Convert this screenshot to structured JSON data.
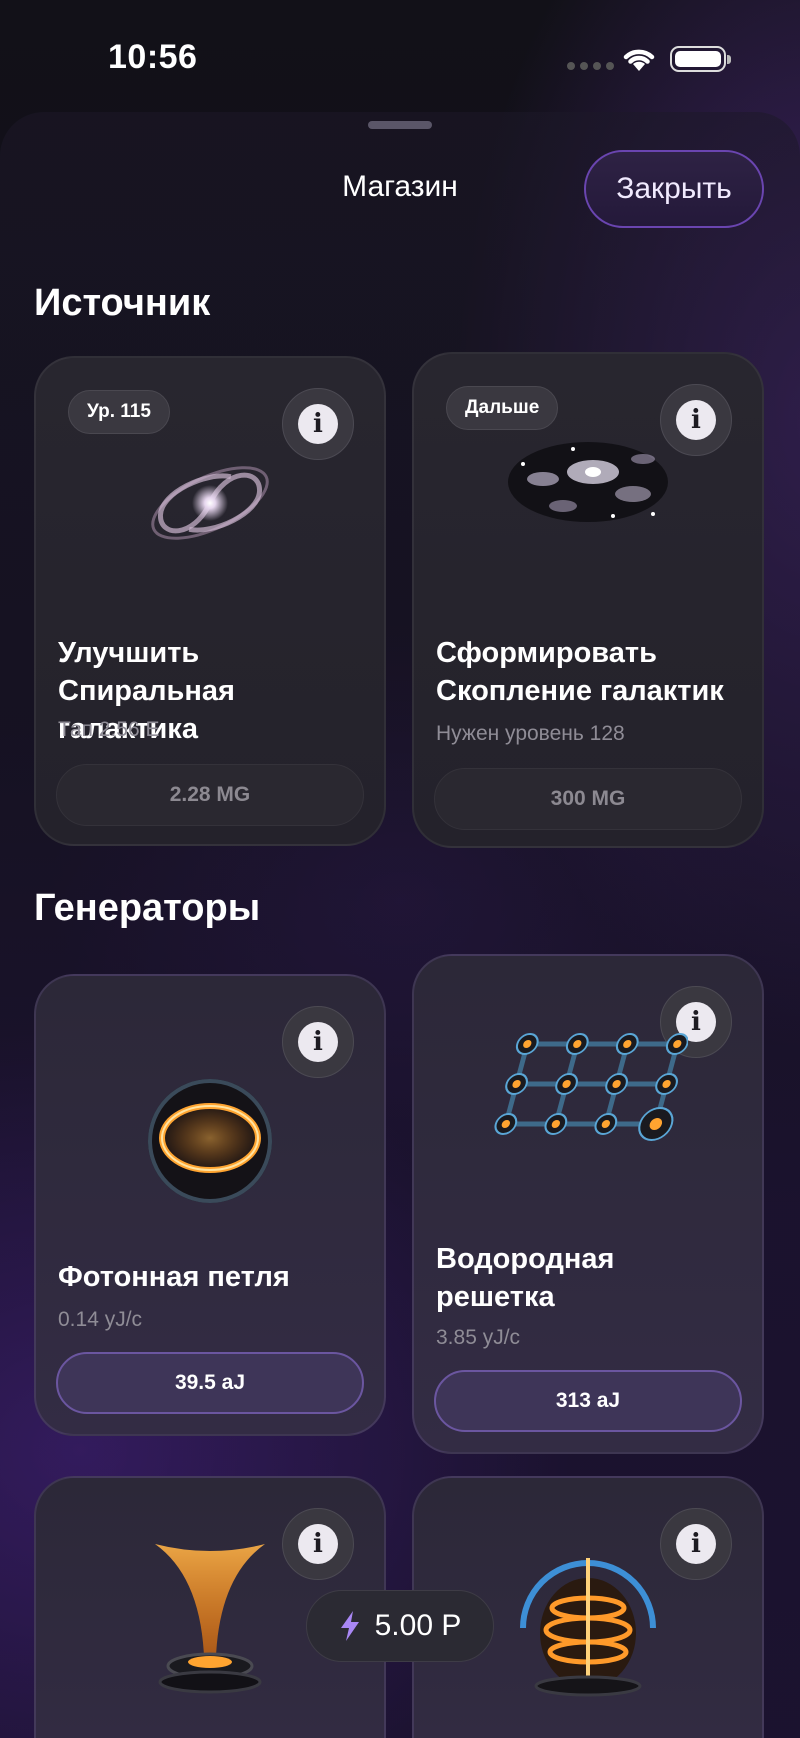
{
  "status_bar": {
    "time": "10:56"
  },
  "sheet": {
    "title": "Магазин",
    "close_label": "Закрыть"
  },
  "sections": [
    {
      "title": "Источник",
      "cards": [
        {
          "badge": "Ур. 115",
          "title_line1": "Улучшить Спиральная",
          "title_line2": "галактика",
          "subtitle": "Тап 2.56 E",
          "price": "2.28 MG",
          "icon": "spiral-galaxy-icon"
        },
        {
          "badge": "Дальше",
          "title_line1": "Сформировать",
          "title_line2": "Скопление галактик",
          "subtitle": "Нужен уровень 128",
          "price": "300 MG",
          "icon": "galaxy-cluster-icon"
        }
      ]
    },
    {
      "title": "Генераторы",
      "cards": [
        {
          "title_line1": "Фотонная петля",
          "title_line2": "",
          "subtitle": "0.14 yJ/c",
          "price": "39.5 aJ",
          "icon": "photon-loop-icon"
        },
        {
          "title_line1": "Водородная",
          "title_line2": "решетка",
          "subtitle": "3.85 yJ/c",
          "price": "313 aJ",
          "icon": "hydrogen-lattice-icon"
        },
        {
          "icon": "energy-funnel-icon"
        },
        {
          "icon": "plasma-reactor-icon"
        }
      ]
    }
  ],
  "balance": {
    "value": "5.00 P",
    "icon": "lightning-icon"
  },
  "info_icon": "i",
  "colors": {
    "accent": "#6b56a0",
    "close_border": "#6a45b0",
    "lightning": "#a987f5"
  }
}
